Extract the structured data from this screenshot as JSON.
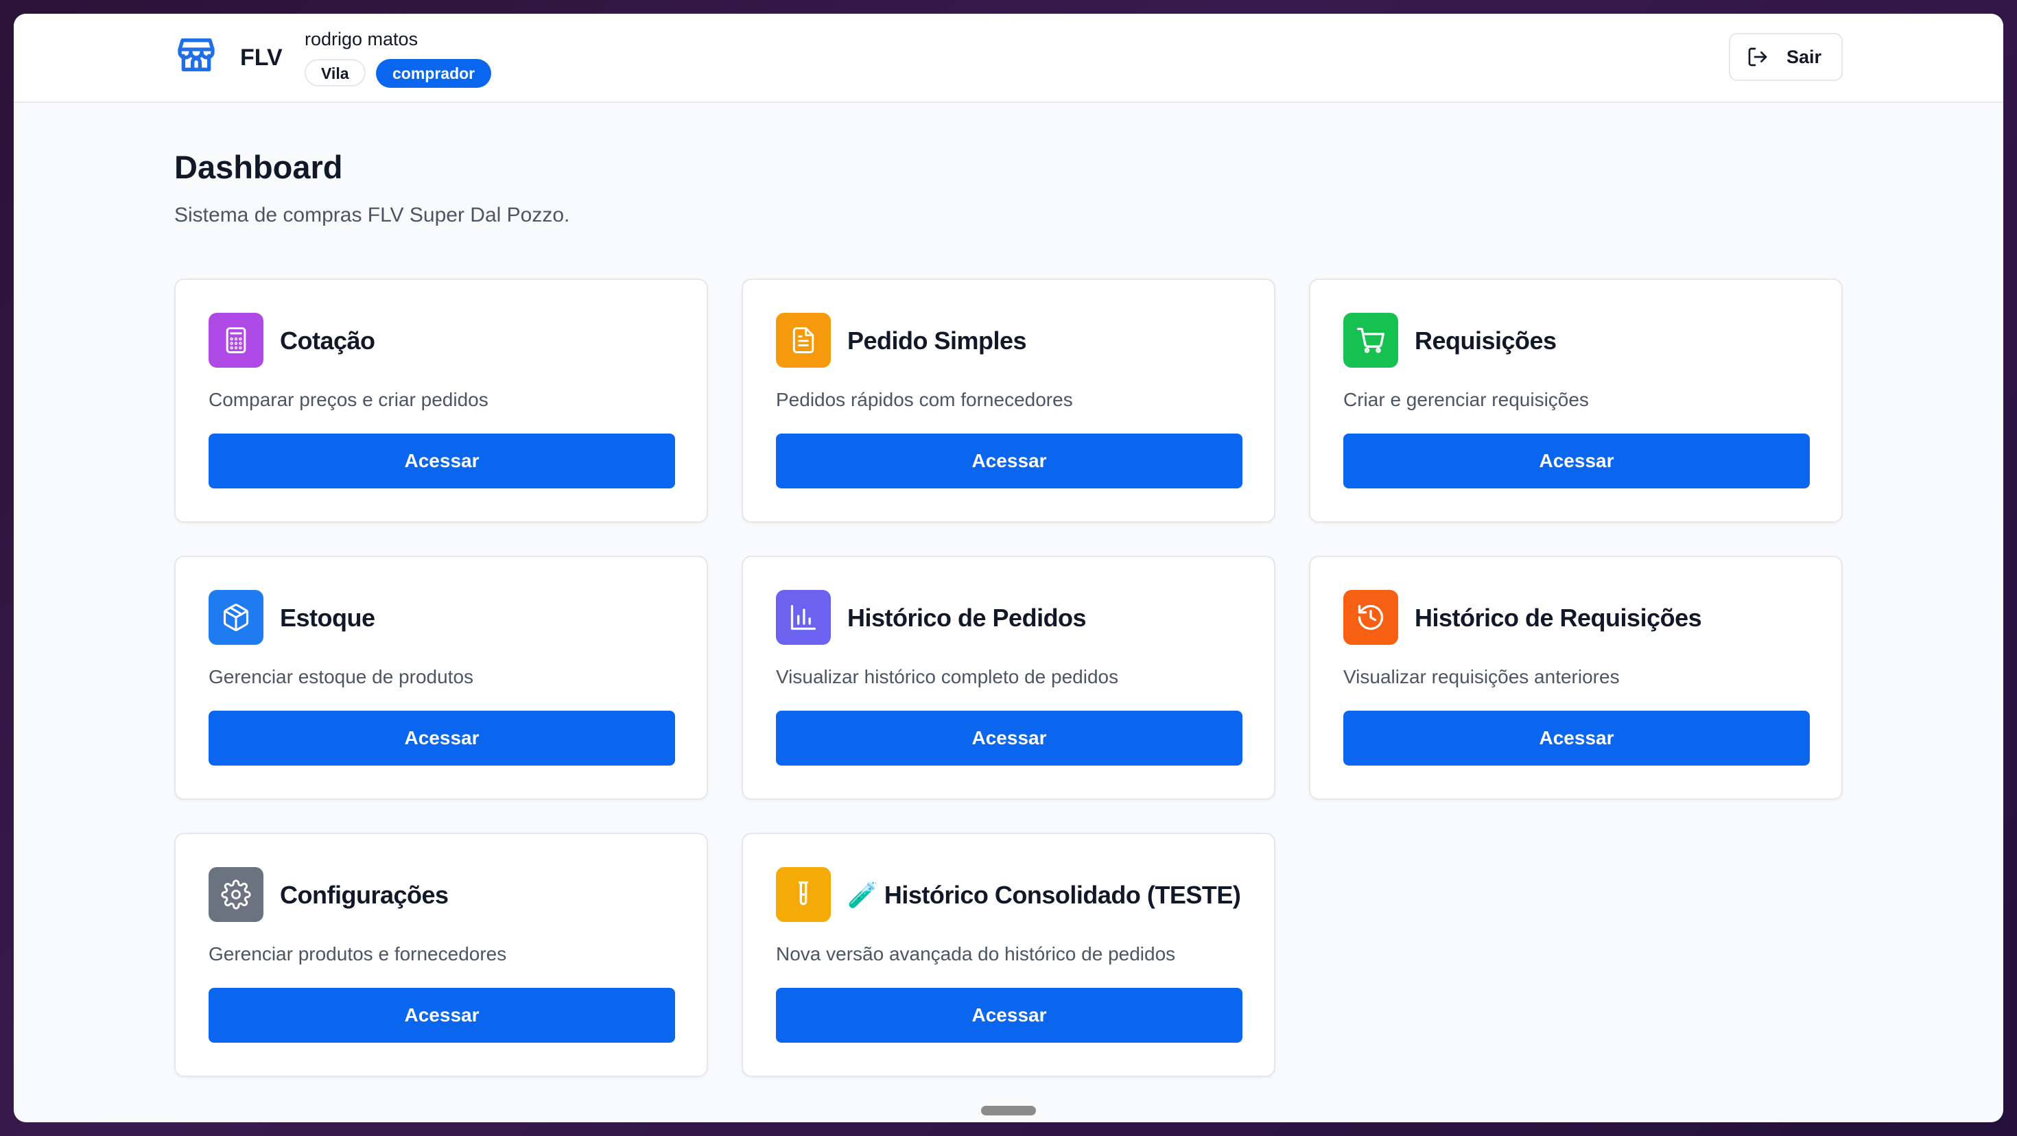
{
  "header": {
    "brand": "FLV",
    "user_name": "rodrigo matos",
    "store_badge": "Vila",
    "role_badge": "comprador",
    "logout_label": "Sair",
    "accent_color": "#0a66ef"
  },
  "page": {
    "title": "Dashboard",
    "subtitle": "Sistema de compras FLV Super Dal Pozzo."
  },
  "cards": [
    {
      "title": "Cotação",
      "description": "Comparar preços e criar pedidos",
      "button": "Acessar",
      "icon": "calculator-icon",
      "color": "#b04ae6"
    },
    {
      "title": "Pedido Simples",
      "description": "Pedidos rápidos com fornecedores",
      "button": "Acessar",
      "icon": "document-icon",
      "color": "#f59a0c"
    },
    {
      "title": "Requisições",
      "description": "Criar e gerenciar requisições",
      "button": "Acessar",
      "icon": "cart-icon",
      "color": "#16c152"
    },
    {
      "title": "Estoque",
      "description": "Gerenciar estoque de produtos",
      "button": "Acessar",
      "icon": "box-icon",
      "color": "#1e7cf0"
    },
    {
      "title": "Histórico de Pedidos",
      "description": "Visualizar histórico completo de pedidos",
      "button": "Acessar",
      "icon": "bar-chart-icon",
      "color": "#6b63f0"
    },
    {
      "title": "Histórico de Requisições",
      "description": "Visualizar requisições anteriores",
      "button": "Acessar",
      "icon": "history-icon",
      "color": "#f76012"
    },
    {
      "title": "Configurações",
      "description": "Gerenciar produtos e fornecedores",
      "button": "Acessar",
      "icon": "gear-icon",
      "color": "#6b7280"
    },
    {
      "title": "🧪 Histórico Consolidado (TESTE)",
      "description": "Nova versão avançada do histórico de pedidos",
      "button": "Acessar",
      "icon": "test-tube-icon",
      "color": "#f5aa06"
    }
  ]
}
